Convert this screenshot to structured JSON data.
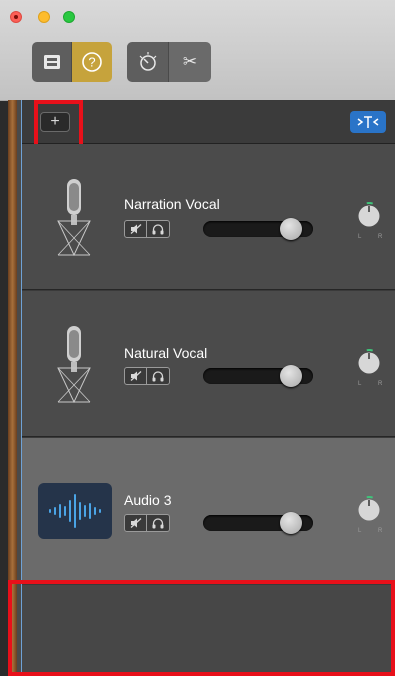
{
  "window": {
    "controls": [
      "close",
      "minimize",
      "zoom"
    ]
  },
  "toolbar": {
    "buttons": [
      {
        "name": "library",
        "icon": "library-icon",
        "active": false
      },
      {
        "name": "help",
        "icon": "help-icon",
        "active": true,
        "glyph": "?"
      },
      {
        "name": "smart-controls",
        "icon": "smart-controls-icon",
        "active": false
      },
      {
        "name": "editors",
        "icon": "scissors-icon",
        "active": false,
        "glyph": "✂"
      }
    ]
  },
  "track_header": {
    "add_label": "+",
    "filter_icon": "track-filter-icon"
  },
  "tracks": [
    {
      "name": "Narration Vocal",
      "icon": "microphone-icon",
      "volume": 0.88,
      "pan": 0,
      "pan_left": "L",
      "pan_right": "R"
    },
    {
      "name": "Natural Vocal",
      "icon": "microphone-icon",
      "volume": 0.88,
      "pan": 0,
      "pan_left": "L",
      "pan_right": "R"
    },
    {
      "name": "Audio 3",
      "icon": "waveform-icon",
      "volume": 0.88,
      "pan": 0,
      "pan_left": "L",
      "pan_right": "R"
    }
  ],
  "highlights": [
    "add-track-button",
    "empty-track-area"
  ],
  "colors": {
    "accent_blue": "#2a74c8",
    "help_active": "#c6a33c",
    "highlight_red": "#e8101a",
    "knob_ring": "#3fc47a"
  }
}
